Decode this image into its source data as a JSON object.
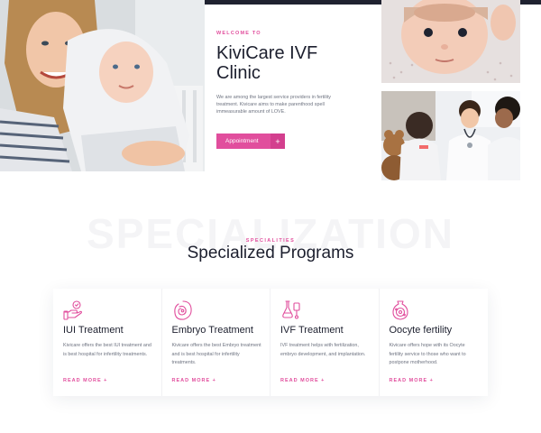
{
  "hero": {
    "eyebrow": "WELCOME TO",
    "title": "KiviCare IVF Clinic",
    "description": "We are among the largest service providers in fertility treatment. Kivicare aims to make parenthood spell immeasurable amount of LOVE.",
    "appointment_label": "Appointment",
    "appointment_icon": "plus-icon",
    "images": [
      "mother-with-baby-photo",
      "baby-lying-photo",
      "doctor-with-child-photo"
    ]
  },
  "section": {
    "watermark": "SPECIALIZATION",
    "eyebrow": "SPECIALITIES",
    "title": "Specialized Programs"
  },
  "cards": [
    {
      "icon": "iui-hands-icon",
      "title": "IUI Treatment",
      "description": "Kivicare offers the best IUI treatment and is best hospital for infertility treatments.",
      "link": "READ MORE +"
    },
    {
      "icon": "embryo-icon",
      "title": "Embryo Treatment",
      "description": "Kivicare offers the best Embryo treatment and is best hospital for infertility treatments.",
      "link": "READ MORE +"
    },
    {
      "icon": "ivf-lab-icon",
      "title": "IVF Treatment",
      "description": "IVF treatment helps with fertilization, embryo development, and implantation.",
      "link": "READ MORE +"
    },
    {
      "icon": "oocyte-icon",
      "title": "Oocyte fertility",
      "description": "Kivicare offers hope with its Oocyte fertility service to those who want to postpone motherhood.",
      "link": "READ MORE +"
    }
  ],
  "colors": {
    "accent": "#e14e9d",
    "accent_dark": "#d33f8e",
    "heading": "#1c1f2e",
    "body_text": "#6e7380",
    "topbar": "#1f2230"
  }
}
